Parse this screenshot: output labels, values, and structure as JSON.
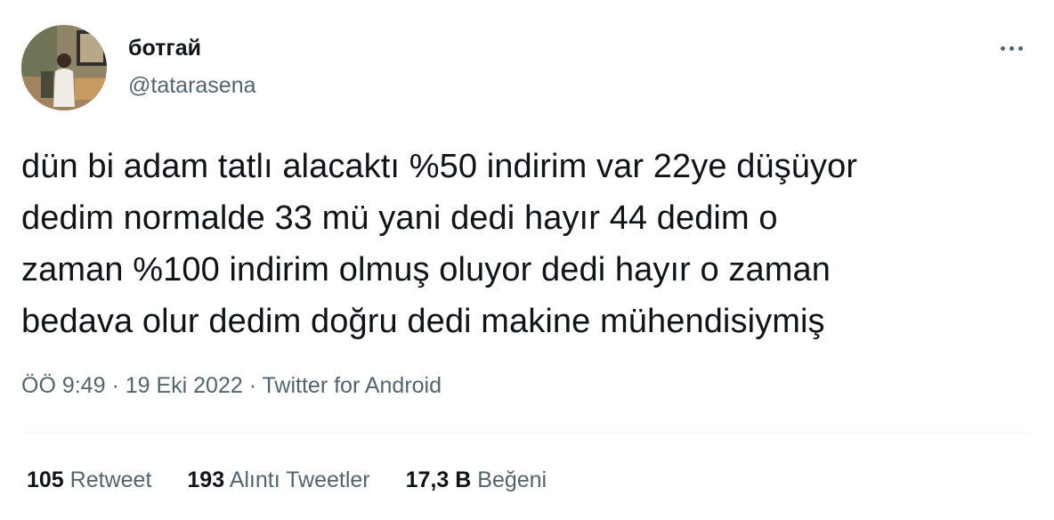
{
  "author": {
    "display_name": "ботгай",
    "handle": "@tatarasena"
  },
  "more_icon": "more-horizontal-icon",
  "tweet": {
    "lines": [
      "dün bi adam tatlı alacaktı %50 indirim var 22ye düşüyor",
      "dedim normalde 33 mü yani dedi hayır 44 dedim o",
      "zaman %100 indirim olmuş oluyor dedi hayır o zaman",
      "bedava olur dedim doğru dedi makine mühendisiymiş"
    ]
  },
  "meta": {
    "time": "ÖÖ 9:49",
    "sep": " · ",
    "date": "19 Eki 2022",
    "source": "Twitter for Android"
  },
  "stats": [
    {
      "value": "105",
      "label": "Retweet"
    },
    {
      "value": "193",
      "label": "Alıntı Tweetler"
    },
    {
      "value": "17,3 B",
      "label": "Beğeni"
    }
  ],
  "colors": {
    "primary_text": "#0f1419",
    "secondary_text": "#536471",
    "divider": "#eff3f4"
  }
}
